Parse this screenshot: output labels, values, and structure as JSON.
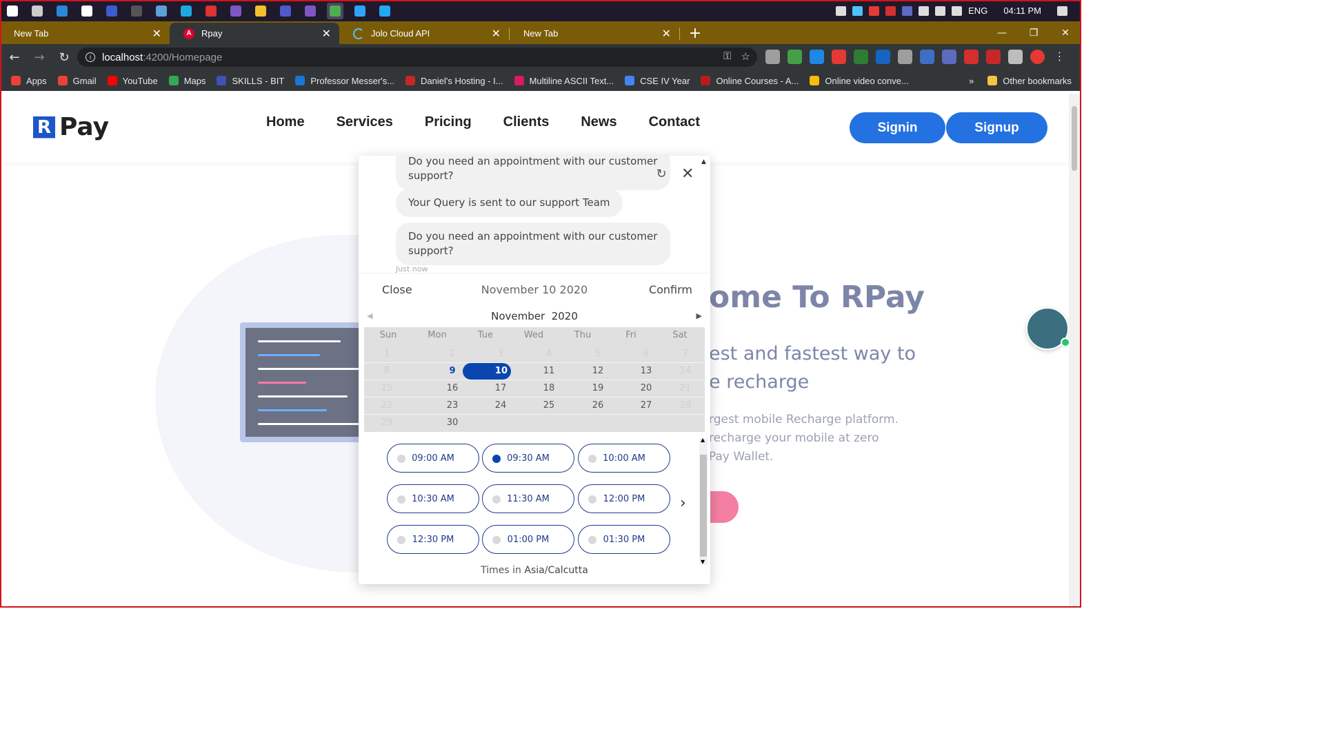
{
  "taskbar": {
    "apps": [
      "start-icon",
      "task-view-icon",
      "screen-tool-icon",
      "notion-icon",
      "visio-icon",
      "terminal-icon",
      "photos-icon",
      "edge-icon",
      "git-icon",
      "visual-studio-icon",
      "file-explorer-icon",
      "teams-icon",
      "visual-studio-icon",
      "chrome-icon",
      "photoshop-icon",
      "vscode-icon"
    ],
    "language": "ENG",
    "time": "04:11 PM"
  },
  "tabs": [
    {
      "title": "New Tab",
      "icon": "none"
    },
    {
      "title": "Rpay",
      "icon": "angular-icon",
      "active": true
    },
    {
      "title": "Jolo Cloud API",
      "icon": "loading-icon"
    },
    {
      "title": "New Tab",
      "icon": "none"
    }
  ],
  "address": {
    "host": "localhost",
    "path": ":4200/Homepage"
  },
  "bookmarks": [
    {
      "label": "Apps",
      "color": "#e94235"
    },
    {
      "label": "Gmail",
      "color": "#ea4335"
    },
    {
      "label": "YouTube",
      "color": "#ff0000"
    },
    {
      "label": "Maps",
      "color": "#34a853"
    },
    {
      "label": "SKILLS - BIT",
      "color": "#3f51b5"
    },
    {
      "label": "Professor Messer's...",
      "color": "#1976d2"
    },
    {
      "label": "Daniel's Hosting - I...",
      "color": "#c62828"
    },
    {
      "label": "Multiline ASCII Text...",
      "color": "#d81b60"
    },
    {
      "label": "CSE IV Year",
      "color": "#4285f4"
    },
    {
      "label": "Online Courses - A...",
      "color": "#b71c1c"
    },
    {
      "label": "Online video conve...",
      "color": "#fbbc04"
    }
  ],
  "other_bookmarks": "Other bookmarks",
  "site": {
    "logo": "Pay",
    "nav": [
      "Home",
      "Services",
      "Pricing",
      "Clients",
      "News",
      "Contact"
    ],
    "signin": "Signin",
    "signup": "Signup",
    "hero_title": "ome To RPay",
    "hero_sub_1": "est and fastest way to",
    "hero_sub_2": "e recharge",
    "hero_p_1": "rgest mobile Recharge platform.",
    "hero_p_2": "recharge your mobile at zero",
    "hero_p_3": "Pay Wallet."
  },
  "chat": {
    "messages": [
      "Do you need an appointment with our customer support?",
      "Your Query is sent to our support Team",
      "Do you need an appointment with our customer support?"
    ],
    "timestamp": "Just now"
  },
  "calendar": {
    "close": "Close",
    "selected_date": "November 10 2020",
    "confirm": "Confirm",
    "month": "November",
    "year": "2020",
    "weekdays": [
      "Sun",
      "Mon",
      "Tue",
      "Wed",
      "Thu",
      "Fri",
      "Sat"
    ],
    "weeks": [
      [
        "1",
        "2",
        "3",
        "4",
        "5",
        "6",
        "7"
      ],
      [
        "8",
        "9",
        "10",
        "11",
        "12",
        "13",
        "14"
      ],
      [
        "15",
        "16",
        "17",
        "18",
        "19",
        "20",
        "21"
      ],
      [
        "22",
        "23",
        "24",
        "25",
        "26",
        "27",
        "28"
      ],
      [
        "29",
        "30",
        "",
        "",
        "",
        "",
        ""
      ]
    ],
    "today": "9",
    "selected": "10",
    "time_slots": [
      "09:00 AM",
      "09:30 AM",
      "10:00 AM",
      "10:30 AM",
      "11:30 AM",
      "12:00 PM",
      "12:30 PM",
      "01:00 PM",
      "01:30 PM"
    ],
    "selected_slot": "09:30 AM",
    "timezone_prefix": "Times in",
    "timezone": "Asia/Calcutta"
  },
  "colors": {
    "accent": "#2471e2",
    "calendar_selected": "#0b46b0",
    "tabstrip": "#7a5c08",
    "frame": "#d3121c"
  }
}
